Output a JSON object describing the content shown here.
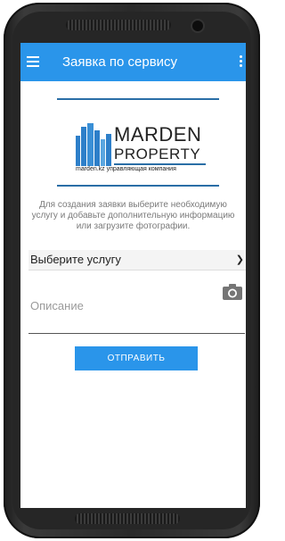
{
  "app_bar": {
    "title": "Заявка по сервису",
    "menu_icon": "hamburger-menu-icon",
    "overflow_icon": "more-vertical-icon",
    "color": "#2a95ea"
  },
  "logo": {
    "brand_line1": "MARDEN",
    "brand_line2": "PROPERTY",
    "tagline": "marden.kz  управляющая  компания",
    "icon": "building-logo-icon"
  },
  "form": {
    "hint": "Для создания заявки выберите необходимую услугу и добавьте дополнительную информацию или загрузите фотографии.",
    "service_select_value": "Выберите услугу",
    "select_icon": "chevron-down-icon",
    "camera_icon": "camera-icon",
    "description_placeholder": "Описание",
    "submit_label": "ОТПРАВИТЬ"
  }
}
